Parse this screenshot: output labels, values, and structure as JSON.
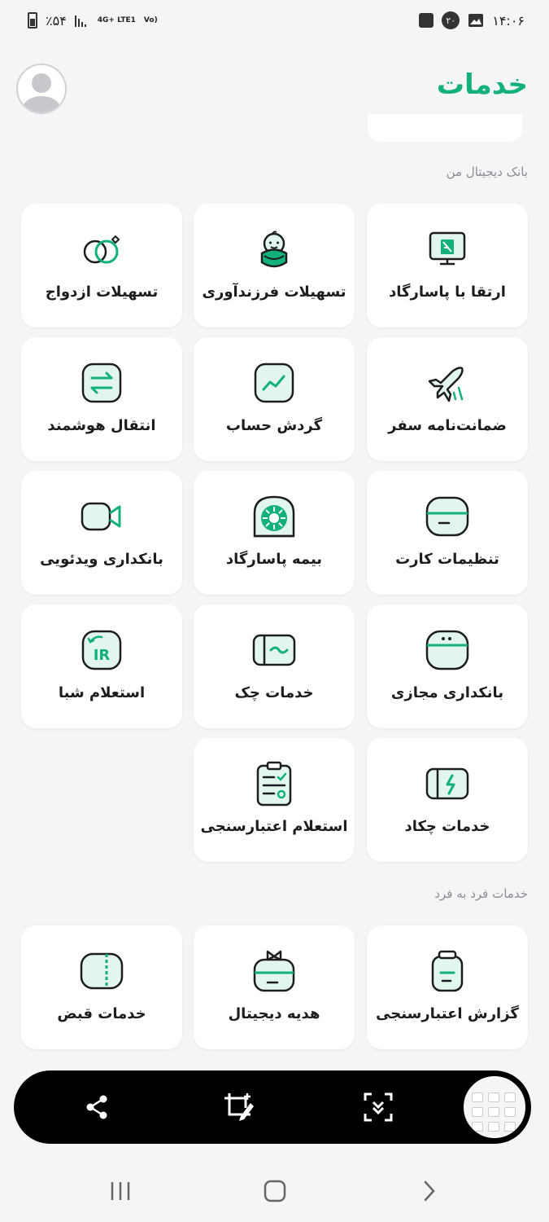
{
  "status_bar": {
    "battery": "٪۵۴",
    "network": "4G+ LTE1",
    "volte": "Vo)",
    "badge_count": "۲۰",
    "time": "۱۴:۰۶"
  },
  "header": {
    "title": "خدمات"
  },
  "sections": [
    {
      "title": "بانک دیجیتال من",
      "items": [
        {
          "label": "ارتقا با پاسارگاد",
          "icon": "upgrade-monitor-icon"
        },
        {
          "label": "تسهیلات فرزندآوری",
          "icon": "baby-icon"
        },
        {
          "label": "تسهیلات ازدواج",
          "icon": "wedding-rings-icon"
        },
        {
          "label": "ضمانت‌نامه سفر",
          "icon": "airplane-icon"
        },
        {
          "label": "گردش حساب",
          "icon": "account-chart-icon"
        },
        {
          "label": "انتقال هوشمند",
          "icon": "transfer-arrows-icon"
        },
        {
          "label": "تنظیمات کارت",
          "icon": "card-settings-icon"
        },
        {
          "label": "بیمه پاسارگاد",
          "icon": "pasargad-insurance-icon"
        },
        {
          "label": "بانکداری ویدئویی",
          "icon": "video-camera-icon"
        },
        {
          "label": "بانکداری مجازی",
          "icon": "virtual-banking-icon"
        },
        {
          "label": "خدمات چک",
          "icon": "cheque-icon"
        },
        {
          "label": "استعلام شبا",
          "icon": "iban-inquiry-icon"
        },
        {
          "label": "خدمات چکاد",
          "icon": "chakad-icon"
        },
        {
          "label": "استعلام اعتبارسنجی",
          "icon": "credit-clipboard-icon"
        }
      ]
    },
    {
      "title": "خدمات فرد به فرد",
      "items": [
        {
          "label": "گزارش اعتبارسنجی",
          "icon": "credit-report-icon"
        },
        {
          "label": "هدیه دیجیتال",
          "icon": "gift-card-icon"
        },
        {
          "label": "خدمات قبض",
          "icon": "bill-icon"
        }
      ]
    }
  ],
  "colors": {
    "accent": "#12b07a",
    "icon_fill": "#e3f6ee",
    "icon_stroke": "#1d1d1f"
  }
}
